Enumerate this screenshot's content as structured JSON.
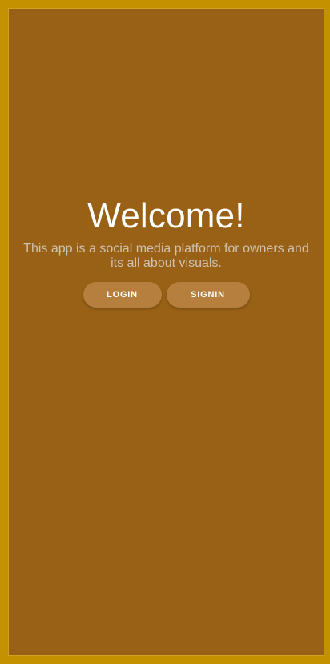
{
  "welcome": {
    "title": "Welcome!",
    "description": "This app is a social media platform for owners and its all about visuals."
  },
  "actions": {
    "login_label": "LOGIN",
    "signin_label": "SIGNIN"
  },
  "colors": {
    "outer_border": "#c49200",
    "screen_background": "#996116",
    "button_background": "#b67f3d",
    "title_text": "#ffffff",
    "description_text": "#cfc2b3"
  }
}
